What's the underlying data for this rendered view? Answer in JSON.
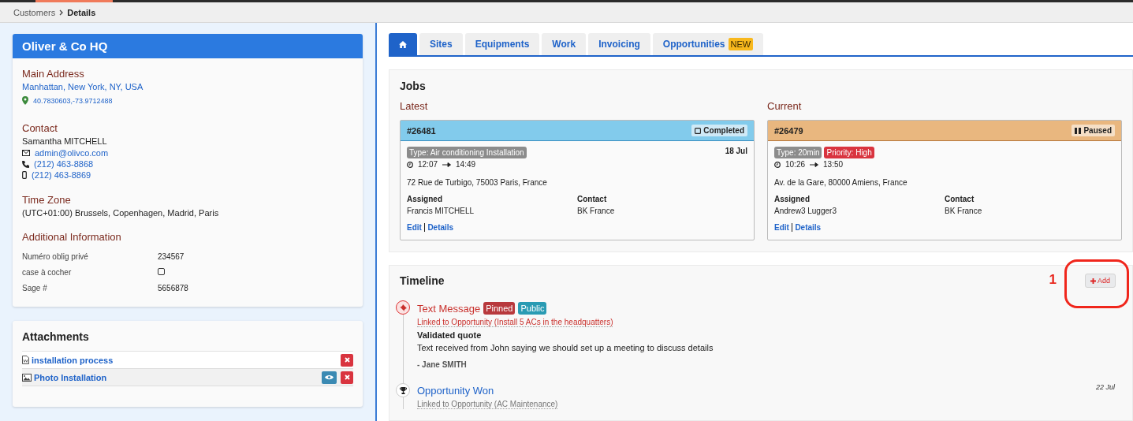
{
  "breadcrumb": [
    {
      "label": "Customers",
      "current": false
    },
    {
      "label": "Details",
      "current": true
    }
  ],
  "customer": {
    "title": "Oliver & Co HQ",
    "address": {
      "heading": "Main Address",
      "line": "Manhattan, New York, NY, USA",
      "coordinates": "40.7830603,-73.9712488"
    },
    "contact": {
      "heading": "Contact",
      "name": "Samantha MITCHELL",
      "email": "admin@olivco.com",
      "phone": "(212) 463-8868",
      "mobile": "(212) 463-8869"
    },
    "time_zone": {
      "heading": "Time Zone",
      "value": "(UTC+01:00) Brussels, Copenhagen, Madrid, Paris"
    },
    "additional": {
      "heading": "Additional Information",
      "fields": [
        {
          "label": "Numéro oblig privé",
          "kind": "text",
          "value": "234567"
        },
        {
          "label": "case à cocher",
          "kind": "checkbox",
          "checked": false
        },
        {
          "label": "Sage #",
          "kind": "text",
          "value": "5656878"
        }
      ]
    }
  },
  "attachments": {
    "title": "Attachments",
    "items": [
      {
        "name": "installation process",
        "kind": "document",
        "viewable": false
      },
      {
        "name": "Photo Installation",
        "kind": "image",
        "viewable": true
      }
    ]
  },
  "tabs": [
    {
      "kind": "home",
      "selected": true
    },
    {
      "kind": "text",
      "label": "Sites",
      "selected": false
    },
    {
      "kind": "text",
      "label": "Equipments",
      "selected": false
    },
    {
      "kind": "text",
      "label": "Work",
      "selected": false
    },
    {
      "kind": "text",
      "label": "Invoicing",
      "selected": false
    },
    {
      "kind": "text",
      "label": "Opportunities",
      "badge": "NEW",
      "selected": false
    }
  ],
  "jobs": {
    "title": "Jobs",
    "groups": [
      {
        "heading": "Latest",
        "job": {
          "number": "#26481",
          "status": {
            "label": "Completed",
            "kind": "completed"
          },
          "tags": [
            {
              "label": "Type: Air conditioning Installation",
              "kind": "type"
            }
          ],
          "date": "18 Jul",
          "time_start": "12:07",
          "time_end": "14:49",
          "address": "72 Rue de Turbigo, 75003 Paris, France",
          "assigned_label": "Assigned",
          "assigned": "Francis MITCHELL",
          "contact_label": "Contact",
          "contact": "BK France",
          "links": [
            "Edit",
            "Details"
          ]
        }
      },
      {
        "heading": "Current",
        "job": {
          "number": "#26479",
          "status": {
            "label": "Paused",
            "kind": "paused"
          },
          "tags": [
            {
              "label": "Type: 20min",
              "kind": "type"
            },
            {
              "label": "Priority: High",
              "kind": "priority"
            }
          ],
          "time_start": "10:26",
          "time_end": "13:50",
          "address": "Av. de la Gare, 80000 Amiens, France",
          "assigned_label": "Assigned",
          "assigned": "Andrew3 Lugger3",
          "contact_label": "Contact",
          "contact": "BK France",
          "links": [
            "Edit",
            "Details"
          ]
        }
      }
    ]
  },
  "timeline": {
    "title": "Timeline",
    "add_button": "Add",
    "annotation": "1",
    "entries": [
      {
        "kind": "message",
        "title": "Text Message",
        "tags": [
          {
            "label": "Pinned",
            "color": "#b8393d"
          },
          {
            "label": "Public",
            "color": "#2a9bb3"
          }
        ],
        "link": "Linked to Opportunity (Install 5 ACs in the headquatters)",
        "subject": "Validated quote",
        "body": "Text received from John saying we should set up a meeting to discuss details",
        "author": "- Jane SMITH"
      },
      {
        "kind": "won",
        "title": "Opportunity Won",
        "date": "22 Jul",
        "link": "Linked to Opportunity (AC Maintenance)"
      }
    ]
  }
}
